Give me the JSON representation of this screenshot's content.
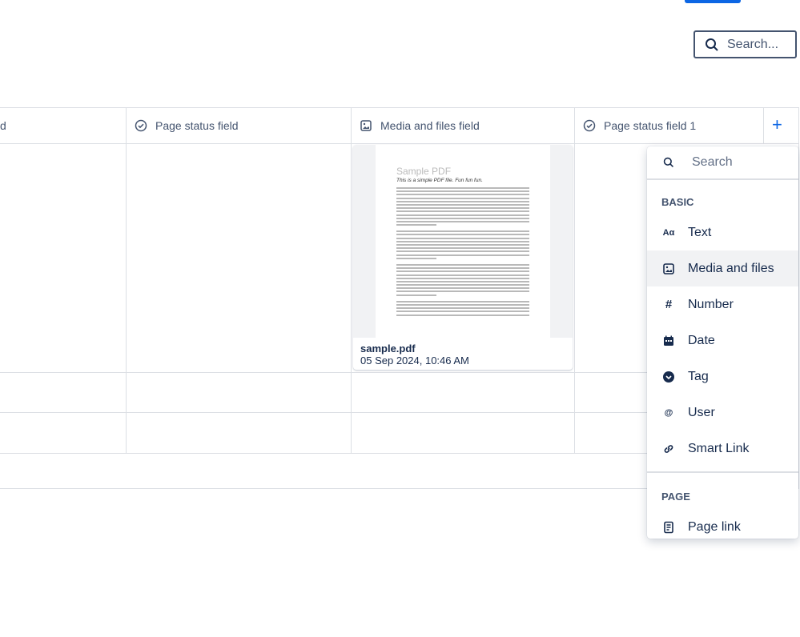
{
  "toolbar": {
    "search_label": "Search...",
    "search_icon": "search-icon"
  },
  "table": {
    "headers": [
      {
        "label": "d",
        "icon": "none"
      },
      {
        "label": "Page status field",
        "icon": "check-circle-icon"
      },
      {
        "label": "Media and files field",
        "icon": "image-icon"
      },
      {
        "label": "Page status field 1",
        "icon": "check-circle-icon"
      }
    ],
    "add_column_label": "+",
    "media_cell": {
      "filename": "sample.pdf",
      "timestamp": "05 Sep 2024, 10:46 AM",
      "preview_title": "Sample PDF",
      "preview_subtitle": "This is a simple PDF file. Fun fun fun."
    }
  },
  "field_menu": {
    "search_placeholder": "Search",
    "sections": [
      {
        "title": "BASIC",
        "items": [
          {
            "label": "Text",
            "icon": "text-icon",
            "glyph": "Aα"
          },
          {
            "label": "Media and files",
            "icon": "image-icon",
            "glyph": ""
          },
          {
            "label": "Number",
            "icon": "hash-icon",
            "glyph": "#"
          },
          {
            "label": "Date",
            "icon": "calendar-icon",
            "glyph": ""
          },
          {
            "label": "Tag",
            "icon": "tag-icon",
            "glyph": ""
          },
          {
            "label": "User",
            "icon": "at-icon",
            "glyph": "@"
          },
          {
            "label": "Smart Link",
            "icon": "link-icon",
            "glyph": ""
          }
        ]
      },
      {
        "title": "PAGE",
        "items": [
          {
            "label": "Page link",
            "icon": "page-icon",
            "glyph": ""
          }
        ]
      }
    ],
    "highlighted": "Media and files"
  },
  "colors": {
    "accent": "#0c66e4",
    "text": "#172b4d",
    "subtle": "#44546f",
    "border": "#dcdfe4"
  }
}
